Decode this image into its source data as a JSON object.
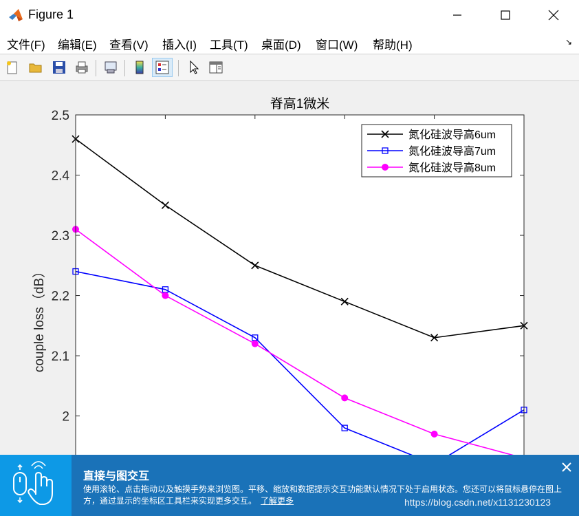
{
  "window": {
    "title": "Figure 1"
  },
  "menu": [
    {
      "label": "文件(F)"
    },
    {
      "label": "编辑(E)"
    },
    {
      "label": "查看(V)"
    },
    {
      "label": "插入(I)"
    },
    {
      "label": "工具(T)"
    },
    {
      "label": "桌面(D)"
    },
    {
      "label": "窗口(W)"
    },
    {
      "label": "帮助(H)"
    }
  ],
  "toolbar": {
    "icons": [
      "new-figure-icon",
      "open-file-icon",
      "save-icon",
      "print-icon",
      "link-plot-icon",
      "colorbar-icon",
      "legend-icon",
      "pointer-icon",
      "property-inspector-icon"
    ]
  },
  "chart_data": {
    "type": "line",
    "title": "脊高1微米",
    "xlabel": "",
    "ylabel": "couple loss（dB）",
    "x": [
      1,
      2,
      3,
      4,
      5,
      6
    ],
    "ylim": [
      1.915,
      2.5
    ],
    "yticks": [
      "1.9",
      "2",
      "2.1",
      "2.2",
      "2.3",
      "2.4",
      "2.5"
    ],
    "yticks_visible": [
      "2",
      "2.1",
      "2.2",
      "2.3",
      "2.4",
      "2.5"
    ],
    "grid": false,
    "legend_position": "top-right",
    "series": [
      {
        "name": "氮化硅波导高6um",
        "color": "#000000",
        "marker": "x",
        "values": [
          2.46,
          2.35,
          2.25,
          2.19,
          2.13,
          2.15
        ]
      },
      {
        "name": "氮化硅波导高7um",
        "color": "#0000ff",
        "marker": "square",
        "values": [
          2.24,
          2.21,
          2.13,
          1.98,
          1.92,
          2.01
        ]
      },
      {
        "name": "氮化硅波导高8um",
        "color": "#ff00ff",
        "marker": "circle",
        "values": [
          2.31,
          2.2,
          2.12,
          2.03,
          1.97,
          1.93
        ]
      }
    ]
  },
  "banner": {
    "title": "直接与图交互",
    "text": "使用滚轮、点击拖动以及触摸手势来浏览图。平移、缩放和数据提示交互功能默认情况下处于启用状态。您还可以将鼠标悬停在图上方，通过显示的坐标区工具栏来实现更多交互。",
    "link": "了解更多"
  },
  "watermark": "https://blog.csdn.net/x1131230123",
  "colors": {
    "banner_bg": "#1a72b8",
    "banner_accent": "#0d99e6"
  }
}
